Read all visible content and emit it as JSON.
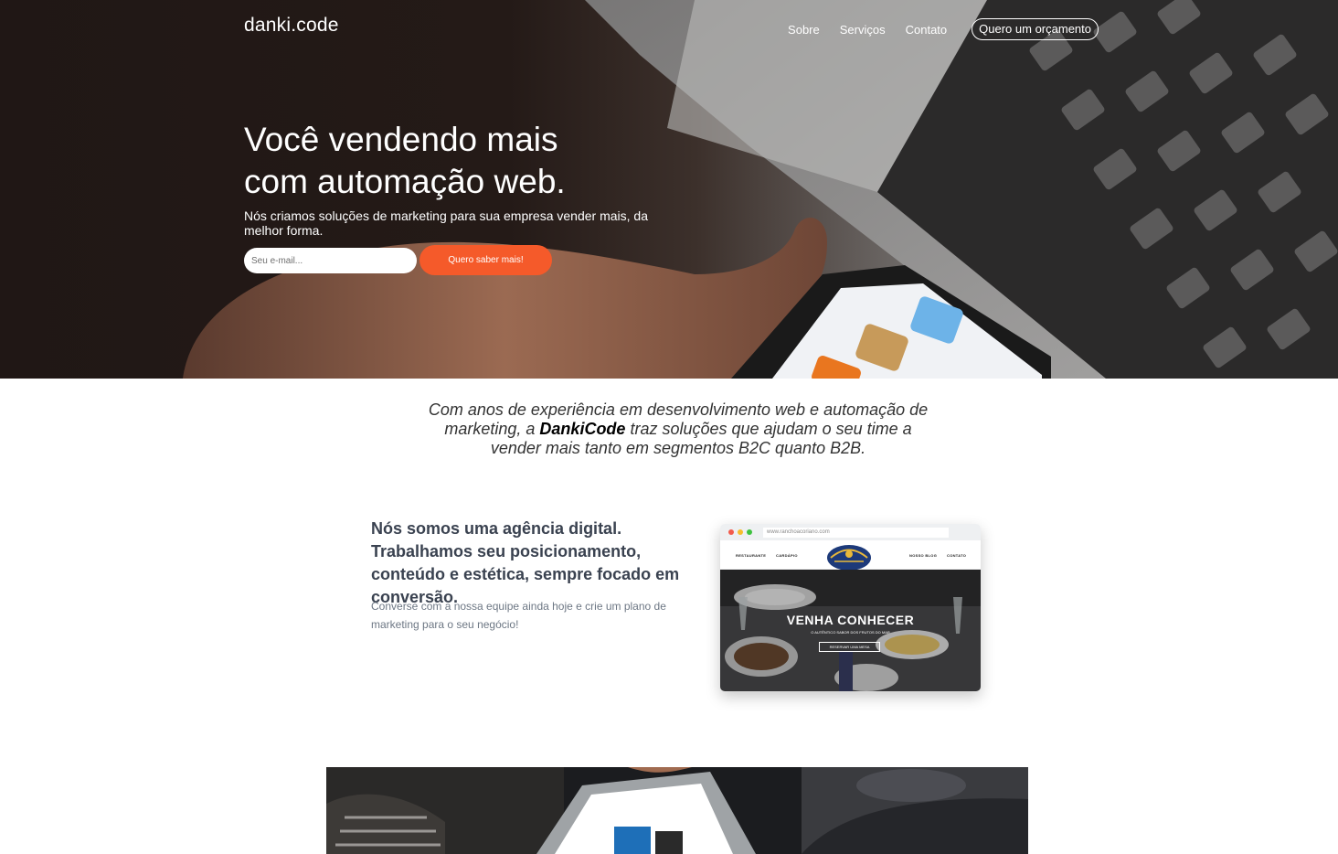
{
  "nav": {
    "logo": "danki.code",
    "links": [
      "Sobre",
      "Serviços",
      "Contato"
    ],
    "cta": "Quero um orçamento"
  },
  "hero": {
    "title_line1": "Você vendendo mais",
    "title_line2": "com automação web.",
    "subtitle": "Nós criamos soluções de marketing para sua empresa vender mais, da melhor forma.",
    "email_placeholder": "Seu e-mail...",
    "button_label": "Quero saber mais!"
  },
  "intro": {
    "before": "Com anos de experiência em desenvolvimento web e automação de marketing, a ",
    "brand": "DankiCode",
    "after": " traz soluções que ajudam o seu time a vender mais tanto em segmentos B2C quanto B2B."
  },
  "agency": {
    "heading": "Nós somos uma agência digital. Trabalhamos seu posicionamento, conteúdo e estética, sempre focado em conversão.",
    "text": "Converse com a nossa equipe ainda hoje e crie um plano de marketing para o seu negócio!"
  },
  "mockup": {
    "url": "www.ranchoacoriano.com",
    "nav_left": [
      "RESTAURANTE",
      "CARDÁPIO"
    ],
    "nav_right": [
      "NOSSO BLOG",
      "CONTATO"
    ],
    "hero_title": "VENHA CONHECER",
    "hero_sub": "O AUTÊNTICO SABOR DOS FRUTOS DO MAR",
    "hero_button": "RESERVAR UMA MESA"
  },
  "colors": {
    "accent": "#f55a2a",
    "hero_dark": "#201715",
    "heading_text": "#3a4250",
    "body_text": "#6d7784"
  },
  "icons": [
    "browser-dot-close-icon",
    "browser-dot-minimize-icon",
    "browser-dot-maximize-icon",
    "restaurant-emblem-icon"
  ]
}
